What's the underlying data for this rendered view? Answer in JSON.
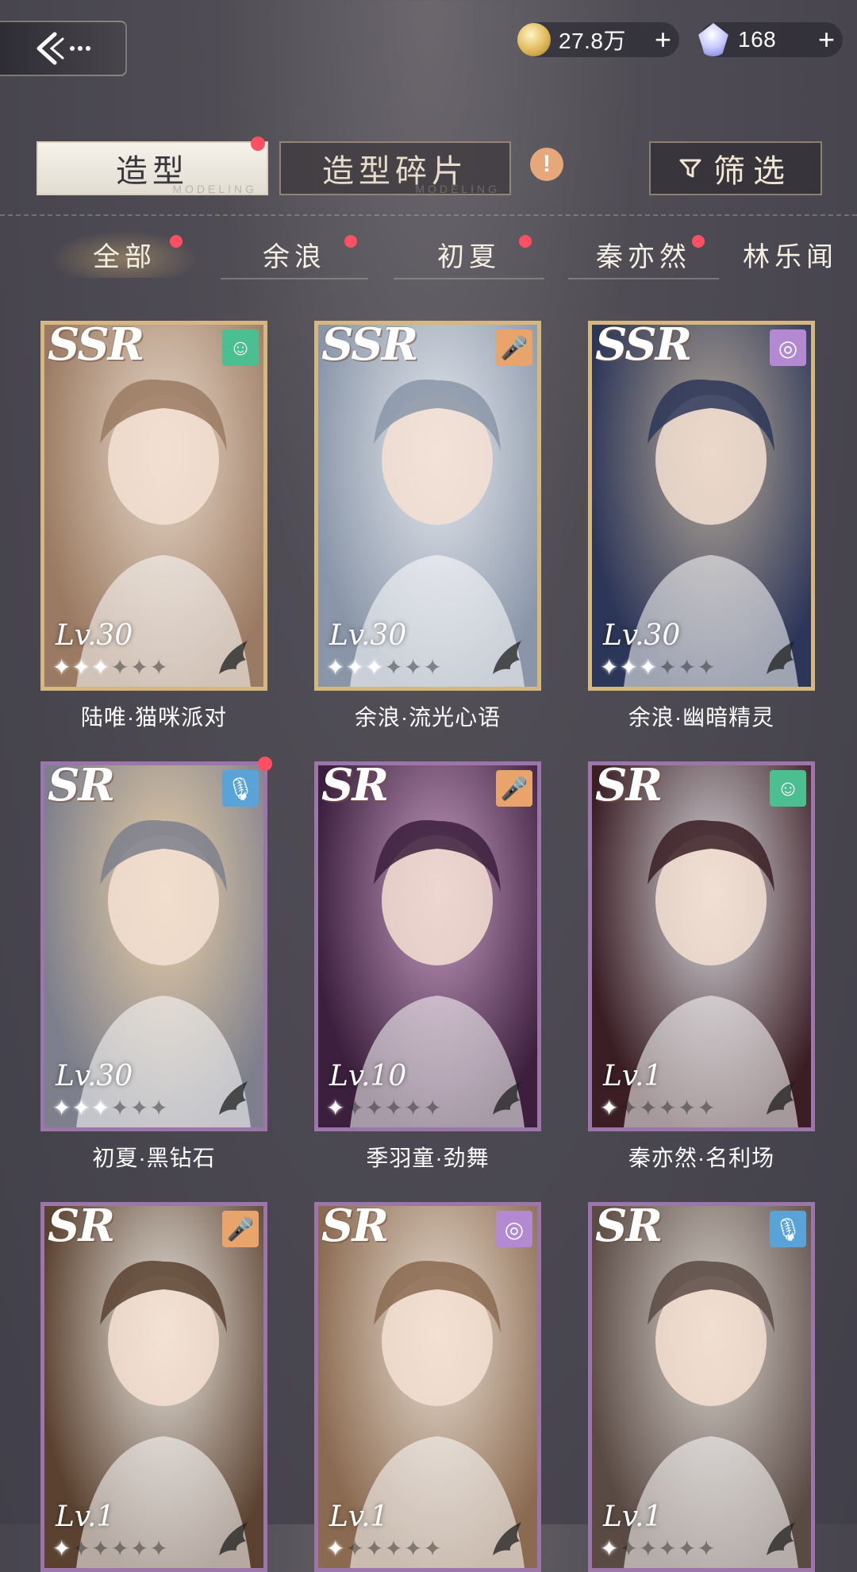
{
  "header": {
    "coins": "27.8万",
    "gems": "168",
    "plus": "+"
  },
  "main_tabs": [
    {
      "label": "造型",
      "ghost": "MODELING",
      "active": true,
      "dot": true
    },
    {
      "label": "造型碎片",
      "ghost": "MODELING",
      "active": false,
      "dot": false
    }
  ],
  "alert_glyph": "!",
  "filter_label": "筛选",
  "char_tabs": [
    {
      "label": "全部",
      "active": true
    },
    {
      "label": "余浪",
      "active": false
    },
    {
      "label": "初夏",
      "active": false
    },
    {
      "label": "秦亦然",
      "active": false
    },
    {
      "label": "林乐闻",
      "active": false
    }
  ],
  "cards": [
    {
      "rarity": "SSR",
      "type_icon": "smile-icon",
      "level": "Lv.30",
      "stars": 3,
      "name": "陆唯·猫咪派对",
      "colors": [
        "#9a7a62",
        "#e8d8c8"
      ],
      "dot": false
    },
    {
      "rarity": "SSR",
      "type_icon": "microphone-icon",
      "level": "Lv.30",
      "stars": 3,
      "name": "余浪·流光心语",
      "colors": [
        "#8a96a8",
        "#e4e8ee"
      ],
      "dot": false
    },
    {
      "rarity": "SSR",
      "type_icon": "circle-icon",
      "level": "Lv.30",
      "stars": 3,
      "name": "余浪·幽暗精灵",
      "colors": [
        "#2c3658",
        "#b5a898"
      ],
      "dot": false
    },
    {
      "rarity": "SR",
      "type_icon": "mic-blue-icon",
      "level": "Lv.30",
      "stars": 3,
      "name": "初夏·黑钻石",
      "colors": [
        "#7d7f8c",
        "#e9cfa7"
      ],
      "dot": true
    },
    {
      "rarity": "SR",
      "type_icon": "microphone-icon",
      "level": "Lv.10",
      "stars": 1,
      "name": "季羽童·劲舞",
      "colors": [
        "#3b1f3c",
        "#c49bc0"
      ],
      "dot": false
    },
    {
      "rarity": "SR",
      "type_icon": "smile-icon",
      "level": "Lv.1",
      "stars": 1,
      "name": "秦亦然·名利场",
      "colors": [
        "#3a1e24",
        "#d8d8dc"
      ],
      "dot": false
    },
    {
      "rarity": "SR",
      "type_icon": "microphone-icon",
      "level": "Lv.1",
      "stars": 1,
      "name": "",
      "colors": [
        "#5b4230",
        "#eae6e0"
      ],
      "dot": false
    },
    {
      "rarity": "SR",
      "type_icon": "circle-icon",
      "level": "Lv.1",
      "stars": 1,
      "name": "",
      "colors": [
        "#8a6a50",
        "#e8dcd0"
      ],
      "dot": false
    },
    {
      "rarity": "SR",
      "type_icon": "mic-blue-icon",
      "level": "Lv.1",
      "stars": 1,
      "name": "",
      "colors": [
        "#5a4a44",
        "#d9d2cc"
      ],
      "dot": false
    }
  ]
}
